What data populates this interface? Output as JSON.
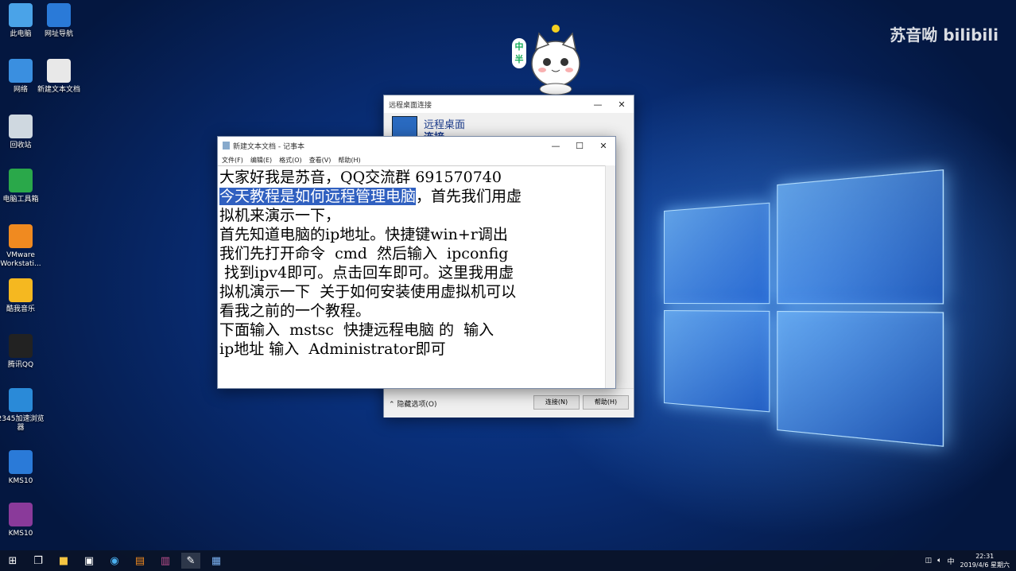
{
  "desktop": {
    "icons": [
      {
        "label": "此电脑",
        "color": "#4aa3e8"
      },
      {
        "label": "网址导航",
        "color": "#2a7ad8"
      },
      {
        "label": "网络",
        "color": "#3a8fe0"
      },
      {
        "label": "新建文本文档",
        "color": "#e8e8e8"
      },
      {
        "label": "回收站",
        "color": "#cfd8e0"
      },
      {
        "label": "电脑工具箱",
        "color": "#2aa84a"
      },
      {
        "label": "VMware Workstati...",
        "color": "#f08a20"
      },
      {
        "label": "酷我音乐",
        "color": "#f5b820"
      },
      {
        "label": "腾讯QQ",
        "color": "#222222"
      },
      {
        "label": "2345加速浏览器",
        "color": "#2a8ad8"
      },
      {
        "label": "KMS10",
        "color": "#2a7ad8"
      },
      {
        "label": "KMS10",
        "color": "#8a3a9a"
      }
    ]
  },
  "watermark": {
    "text": "苏音呦 bilibili",
    "side_text": "中半"
  },
  "rdp": {
    "title": "远程桌面连接",
    "heading": "远程桌面",
    "subheading": "连接",
    "options": "隐藏选项(O)",
    "connect": "连接(N)",
    "help": "帮助(H)"
  },
  "notepad": {
    "title": "新建文本文档 - 记事本",
    "menus": [
      "文件(F)",
      "编辑(E)",
      "格式(O)",
      "查看(V)",
      "帮助(H)"
    ],
    "lines": {
      "l1": "大家好我是苏音，QQ交流群 691570740",
      "l2_sel": "今天教程是如何远程管理电脑",
      "l2_rest": "，首先我们用虚",
      "l3": "拟机来演示一下，",
      "l4": "首先知道电脑的ip地址。快捷键win+r调出",
      "l5": "我们先打开命令  cmd  然后输入  ipconfig",
      "l6": " 找到ipv4即可。点击回车即可。这里我用虚",
      "l7": "拟机演示一下  关于如何安装使用虚拟机可以",
      "l8": "看我之前的一个教程。",
      "l9": "下面输入  mstsc  快捷远程电脑 的  输入",
      "l10": "ip地址 输入  Administrator即可"
    }
  },
  "taskbar": {
    "icons": [
      "start-icon",
      "task-view-icon",
      "explorer-icon",
      "store-icon",
      "browser-icon",
      "vmware-icon",
      "rar-icon",
      "notepad-icon",
      "rdp-icon"
    ],
    "ime": "中",
    "time": "22:31",
    "date": "2019/4/6 星期六"
  }
}
